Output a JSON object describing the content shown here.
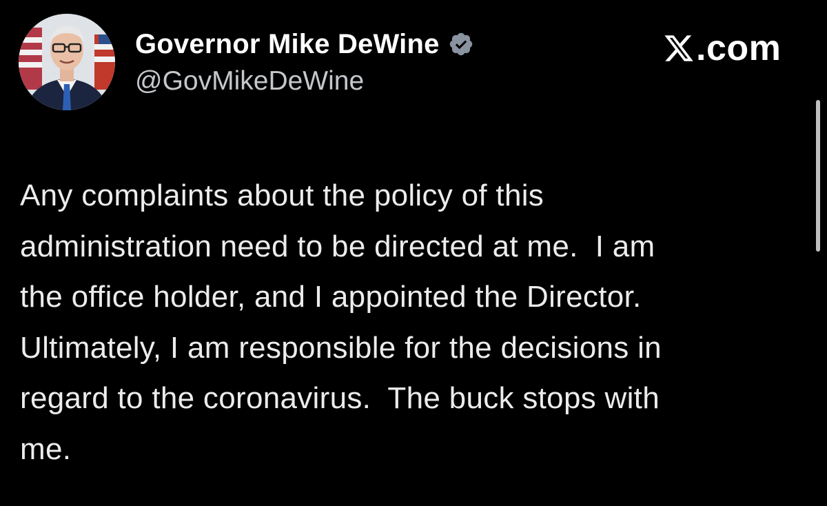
{
  "author": {
    "display_name": "Governor Mike DeWine",
    "handle": "@GovMikeDeWine",
    "verified_icon": "verified-badge-icon",
    "avatar_icon": "profile-photo"
  },
  "brand": {
    "text": ".com",
    "logo_icon": "x-logo-icon"
  },
  "tweet": {
    "lines": [
      "Any complaints about the policy of this",
      "administration need to be directed at me.  I am",
      "the office holder, and I appointed the Director.",
      "Ultimately, I am responsible for the decisions in",
      "regard to the coronavirus.  The buck stops with",
      "me."
    ]
  },
  "colors": {
    "background": "#000000",
    "text": "#ececec",
    "handle": "#c4c8cc",
    "verified": "#8a93a0"
  }
}
